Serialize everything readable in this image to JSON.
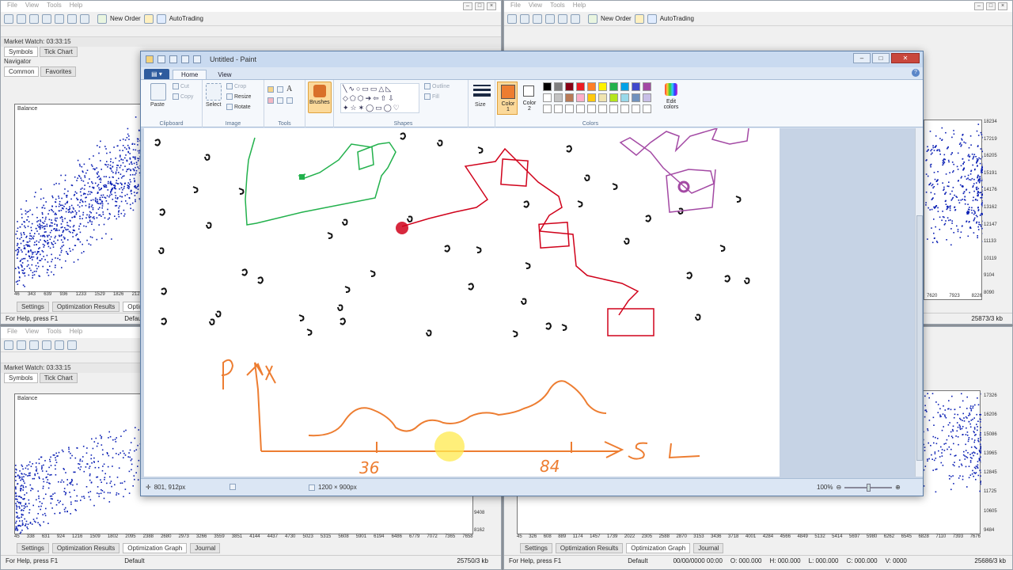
{
  "mt4": {
    "menu": [
      "File",
      "View",
      "Tools",
      "Help"
    ],
    "new_order": "New Order",
    "autotrading": "AutoTrading",
    "market_watch": "Market Watch: 03:33:15",
    "tabs_top": [
      "Symbols",
      "Tick Chart"
    ],
    "navigator": "Navigator",
    "nav_tabs": [
      "Common",
      "Favorites"
    ],
    "balance": "Balance",
    "bottom_tabs": [
      "Settings",
      "Optimization Results",
      "Optimization Graph",
      "Journal"
    ],
    "status_help": "For Help, press F1",
    "status_default": "Default",
    "tl_xticks": [
      "46",
      "343",
      "639",
      "936",
      "1233",
      "1529",
      "1826",
      "2123"
    ],
    "bl_xticks": [
      "45",
      "338",
      "631",
      "924",
      "1216",
      "1509",
      "1802",
      "2095",
      "2388",
      "2680",
      "2973",
      "3266",
      "3559",
      "3851",
      "4144",
      "4437",
      "4730",
      "5023",
      "5315",
      "5608",
      "5901",
      "6194",
      "6486",
      "6779",
      "7072",
      "7365",
      "7658"
    ],
    "bl_yticks": [
      "9408",
      "8162"
    ],
    "bl_kb": "25750/3 kb",
    "tr_yticks": [
      "18234",
      "17219",
      "16205",
      "15191",
      "14176",
      "13162",
      "12147",
      "11133",
      "10119",
      "9104",
      "8090"
    ],
    "tr_xticks": [
      "7620",
      "7923",
      "8226"
    ],
    "tr_kb": "25873/3 kb",
    "br_yticks": [
      "17326",
      "16206",
      "15086",
      "13965",
      "12845",
      "11725",
      "10605",
      "9484"
    ],
    "br_xticks": [
      "45",
      "326",
      "608",
      "889",
      "1174",
      "1457",
      "1739",
      "2022",
      "2305",
      "2588",
      "2870",
      "3153",
      "3436",
      "3718",
      "4001",
      "4284",
      "4566",
      "4849",
      "5132",
      "5414",
      "5697",
      "5980",
      "6262",
      "6545",
      "6828",
      "7110",
      "7393",
      "7676"
    ],
    "br_status": [
      "00/00/0000 00:00",
      "O: 000.000",
      "H: 000.000",
      "L: 000.000",
      "C: 000.000",
      "V: 0000"
    ],
    "br_kb": "25686/3 kb"
  },
  "paint": {
    "title": "Untitled - Paint",
    "ribbon_tabs": [
      "Home",
      "View"
    ],
    "clipboard": {
      "paste": "Paste",
      "cut": "Cut",
      "copy": "Copy",
      "label": "Clipboard"
    },
    "image": {
      "select": "Select",
      "crop": "Crop",
      "resize": "Resize",
      "rotate": "Rotate",
      "label": "Image"
    },
    "tools_label": "Tools",
    "brushes": "Brushes",
    "shapes": {
      "outline": "Outline",
      "fill": "Fill",
      "label": "Shapes"
    },
    "size": "Size",
    "color1": "Color 1",
    "color2": "Color 2",
    "colors_label": "Colors",
    "edit_colors": "Edit colors",
    "palette": [
      "#000000",
      "#7f7f7f",
      "#880015",
      "#ed1c24",
      "#ff7f27",
      "#fff200",
      "#22b14c",
      "#00a2e8",
      "#3f48cc",
      "#a349a4",
      "#ffffff",
      "#c3c3c3",
      "#b97a57",
      "#ffaec9",
      "#ffc90e",
      "#efe4b0",
      "#b5e61d",
      "#99d9ea",
      "#7092be",
      "#c8bfe7"
    ],
    "color1_value": "#ed7d31",
    "status_pos": "801, 912px",
    "status_size": "1200 × 900px",
    "zoom": "100%",
    "sketch": {
      "p_label": "P",
      "tick1": "36",
      "tick2": "84",
      "axis_label": "SL"
    }
  }
}
